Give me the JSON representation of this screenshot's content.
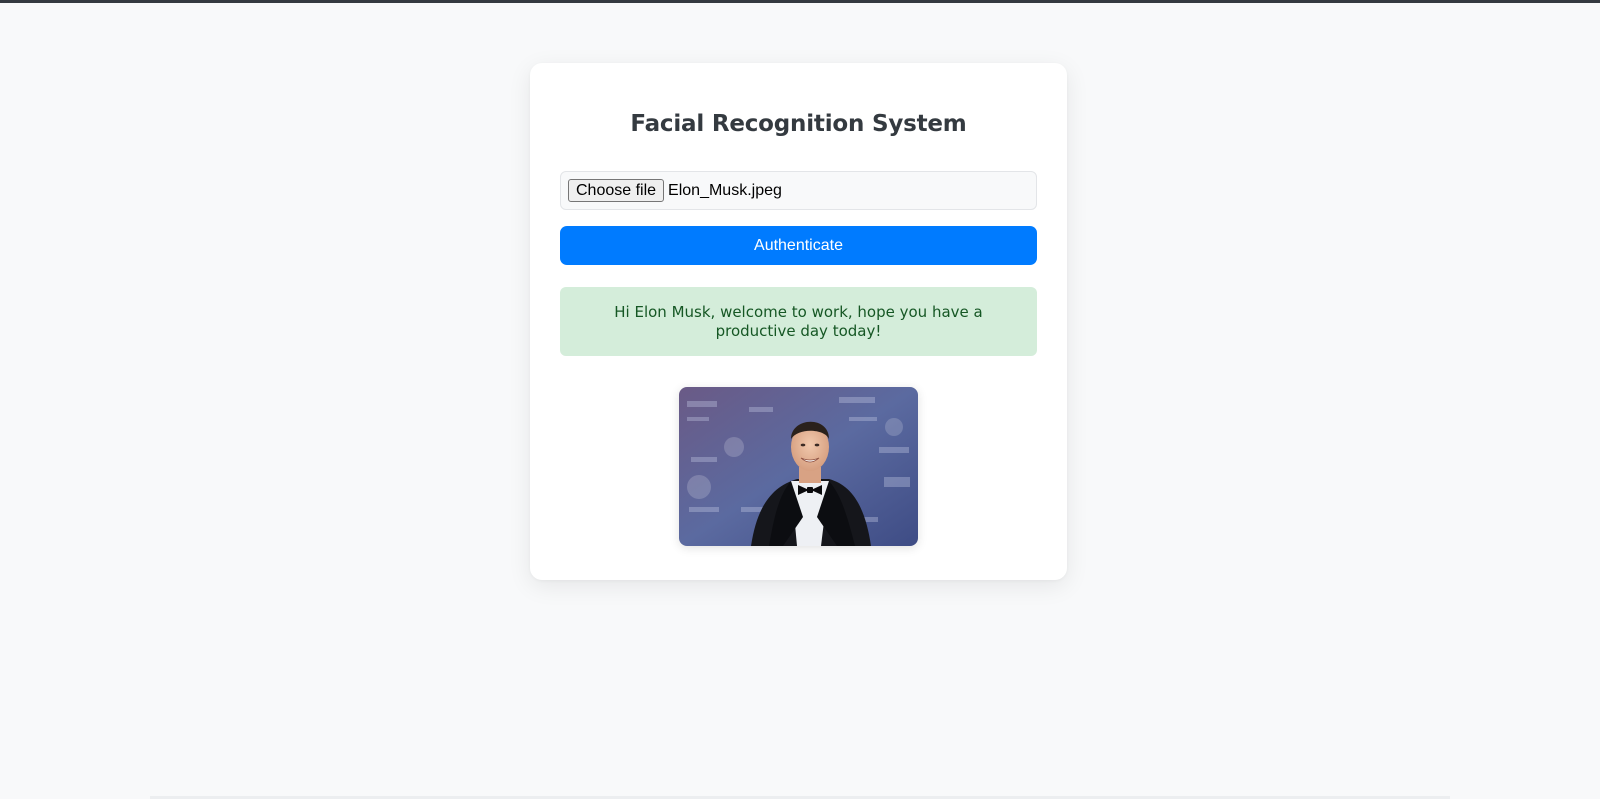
{
  "page": {
    "title": "Facial Recognition System"
  },
  "file_input": {
    "button_label": "Choose file",
    "selected_file": "Elon_Musk.jpeg"
  },
  "actions": {
    "authenticate_label": "Authenticate"
  },
  "result": {
    "message": "Hi Elon Musk, welcome to work, hope you have a productive day today!",
    "status_color": "#d4edda",
    "text_color": "#155724"
  },
  "photo": {
    "alt": "Elon Musk"
  },
  "colors": {
    "accent": "#007bff",
    "background": "#f8f9fa",
    "title": "#343a40"
  }
}
